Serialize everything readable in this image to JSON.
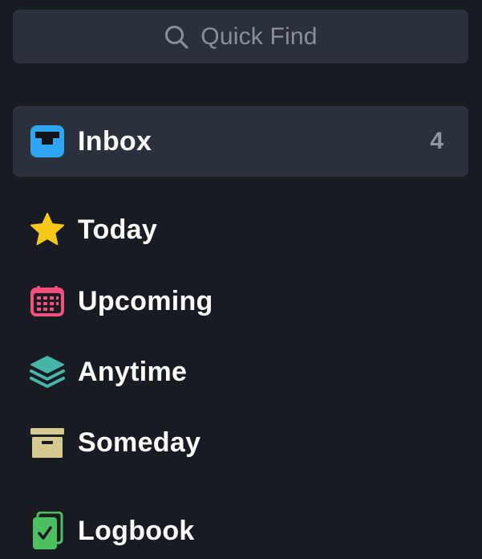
{
  "search": {
    "placeholder": "Quick Find",
    "icon": "search-icon"
  },
  "nav": {
    "inbox": {
      "label": "Inbox",
      "count": "4",
      "icon": "inbox-icon",
      "color": "#2fa6f2"
    },
    "today": {
      "label": "Today",
      "icon": "star-icon",
      "color": "#f8c71c"
    },
    "upcoming": {
      "label": "Upcoming",
      "icon": "calendar-icon",
      "color": "#f24f7d"
    },
    "anytime": {
      "label": "Anytime",
      "icon": "layers-icon",
      "color": "#46b5a8"
    },
    "someday": {
      "label": "Someday",
      "icon": "archive-box-icon",
      "color": "#d5c890"
    },
    "logbook": {
      "label": "Logbook",
      "icon": "logbook-icon",
      "color": "#4cbf5f"
    }
  },
  "colors": {
    "background": "#181b21",
    "selected_background": "#2b313c",
    "text": "#ffffff",
    "muted_text": "#8a909b"
  }
}
